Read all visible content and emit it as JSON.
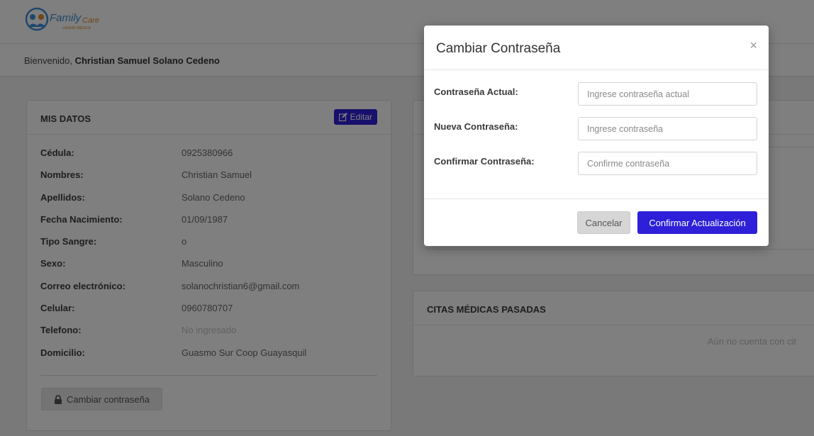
{
  "colors": {
    "accent": "#2e20d8",
    "overlay": "rgba(0,0,0,0.5)",
    "background": "#f2f3f5"
  },
  "header": {
    "logo_text": "FamilyCare",
    "logo_subtext": "UNIDAD MÉDICA",
    "welcome_prefix": "Bienvenido, ",
    "user_name": "Christian Samuel Solano Cedeno"
  },
  "mis_datos": {
    "title": "MIS DATOS",
    "edit_label": "Editar",
    "edit_icon": "edit-icon",
    "rows": [
      {
        "label": "Cédula:",
        "value": "0925380966"
      },
      {
        "label": "Nombres:",
        "value": "Christian Samuel"
      },
      {
        "label": "Apellidos:",
        "value": "Solano Cedeno"
      },
      {
        "label": "Fecha Nacimiento:",
        "value": "01/09/1987"
      },
      {
        "label": "Tipo Sangre:",
        "value": "o"
      },
      {
        "label": "Sexo:",
        "value": "Masculino"
      },
      {
        "label": "Correo electrónico:",
        "value": "solanochristian6@gmail.com"
      },
      {
        "label": "Celular:",
        "value": "0960780707"
      },
      {
        "label": "Telefono:",
        "value": "No ingresado"
      },
      {
        "label": "Domicilio:",
        "value": "Guasmo Sur Coop Guayasquil"
      }
    ],
    "change_password_label": "Cambiar contraseña",
    "change_password_icon": "lock-icon"
  },
  "citas_pasadas": {
    "title": "CITAS MÉDICAS PASADAS",
    "empty_text": "Aún no cuenta con cit"
  },
  "modal": {
    "title": "Cambiar Contraseña",
    "close_symbol": "×",
    "fields": [
      {
        "label": "Contraseña Actual:",
        "placeholder": "Ingrese contraseña actual"
      },
      {
        "label": "Nueva Contraseña:",
        "placeholder": "Ingrese contraseña"
      },
      {
        "label": "Confirmar Contraseña:",
        "placeholder": "Confirme contraseña"
      }
    ],
    "cancel_label": "Cancelar",
    "confirm_label": "Confirmar Actualización"
  }
}
